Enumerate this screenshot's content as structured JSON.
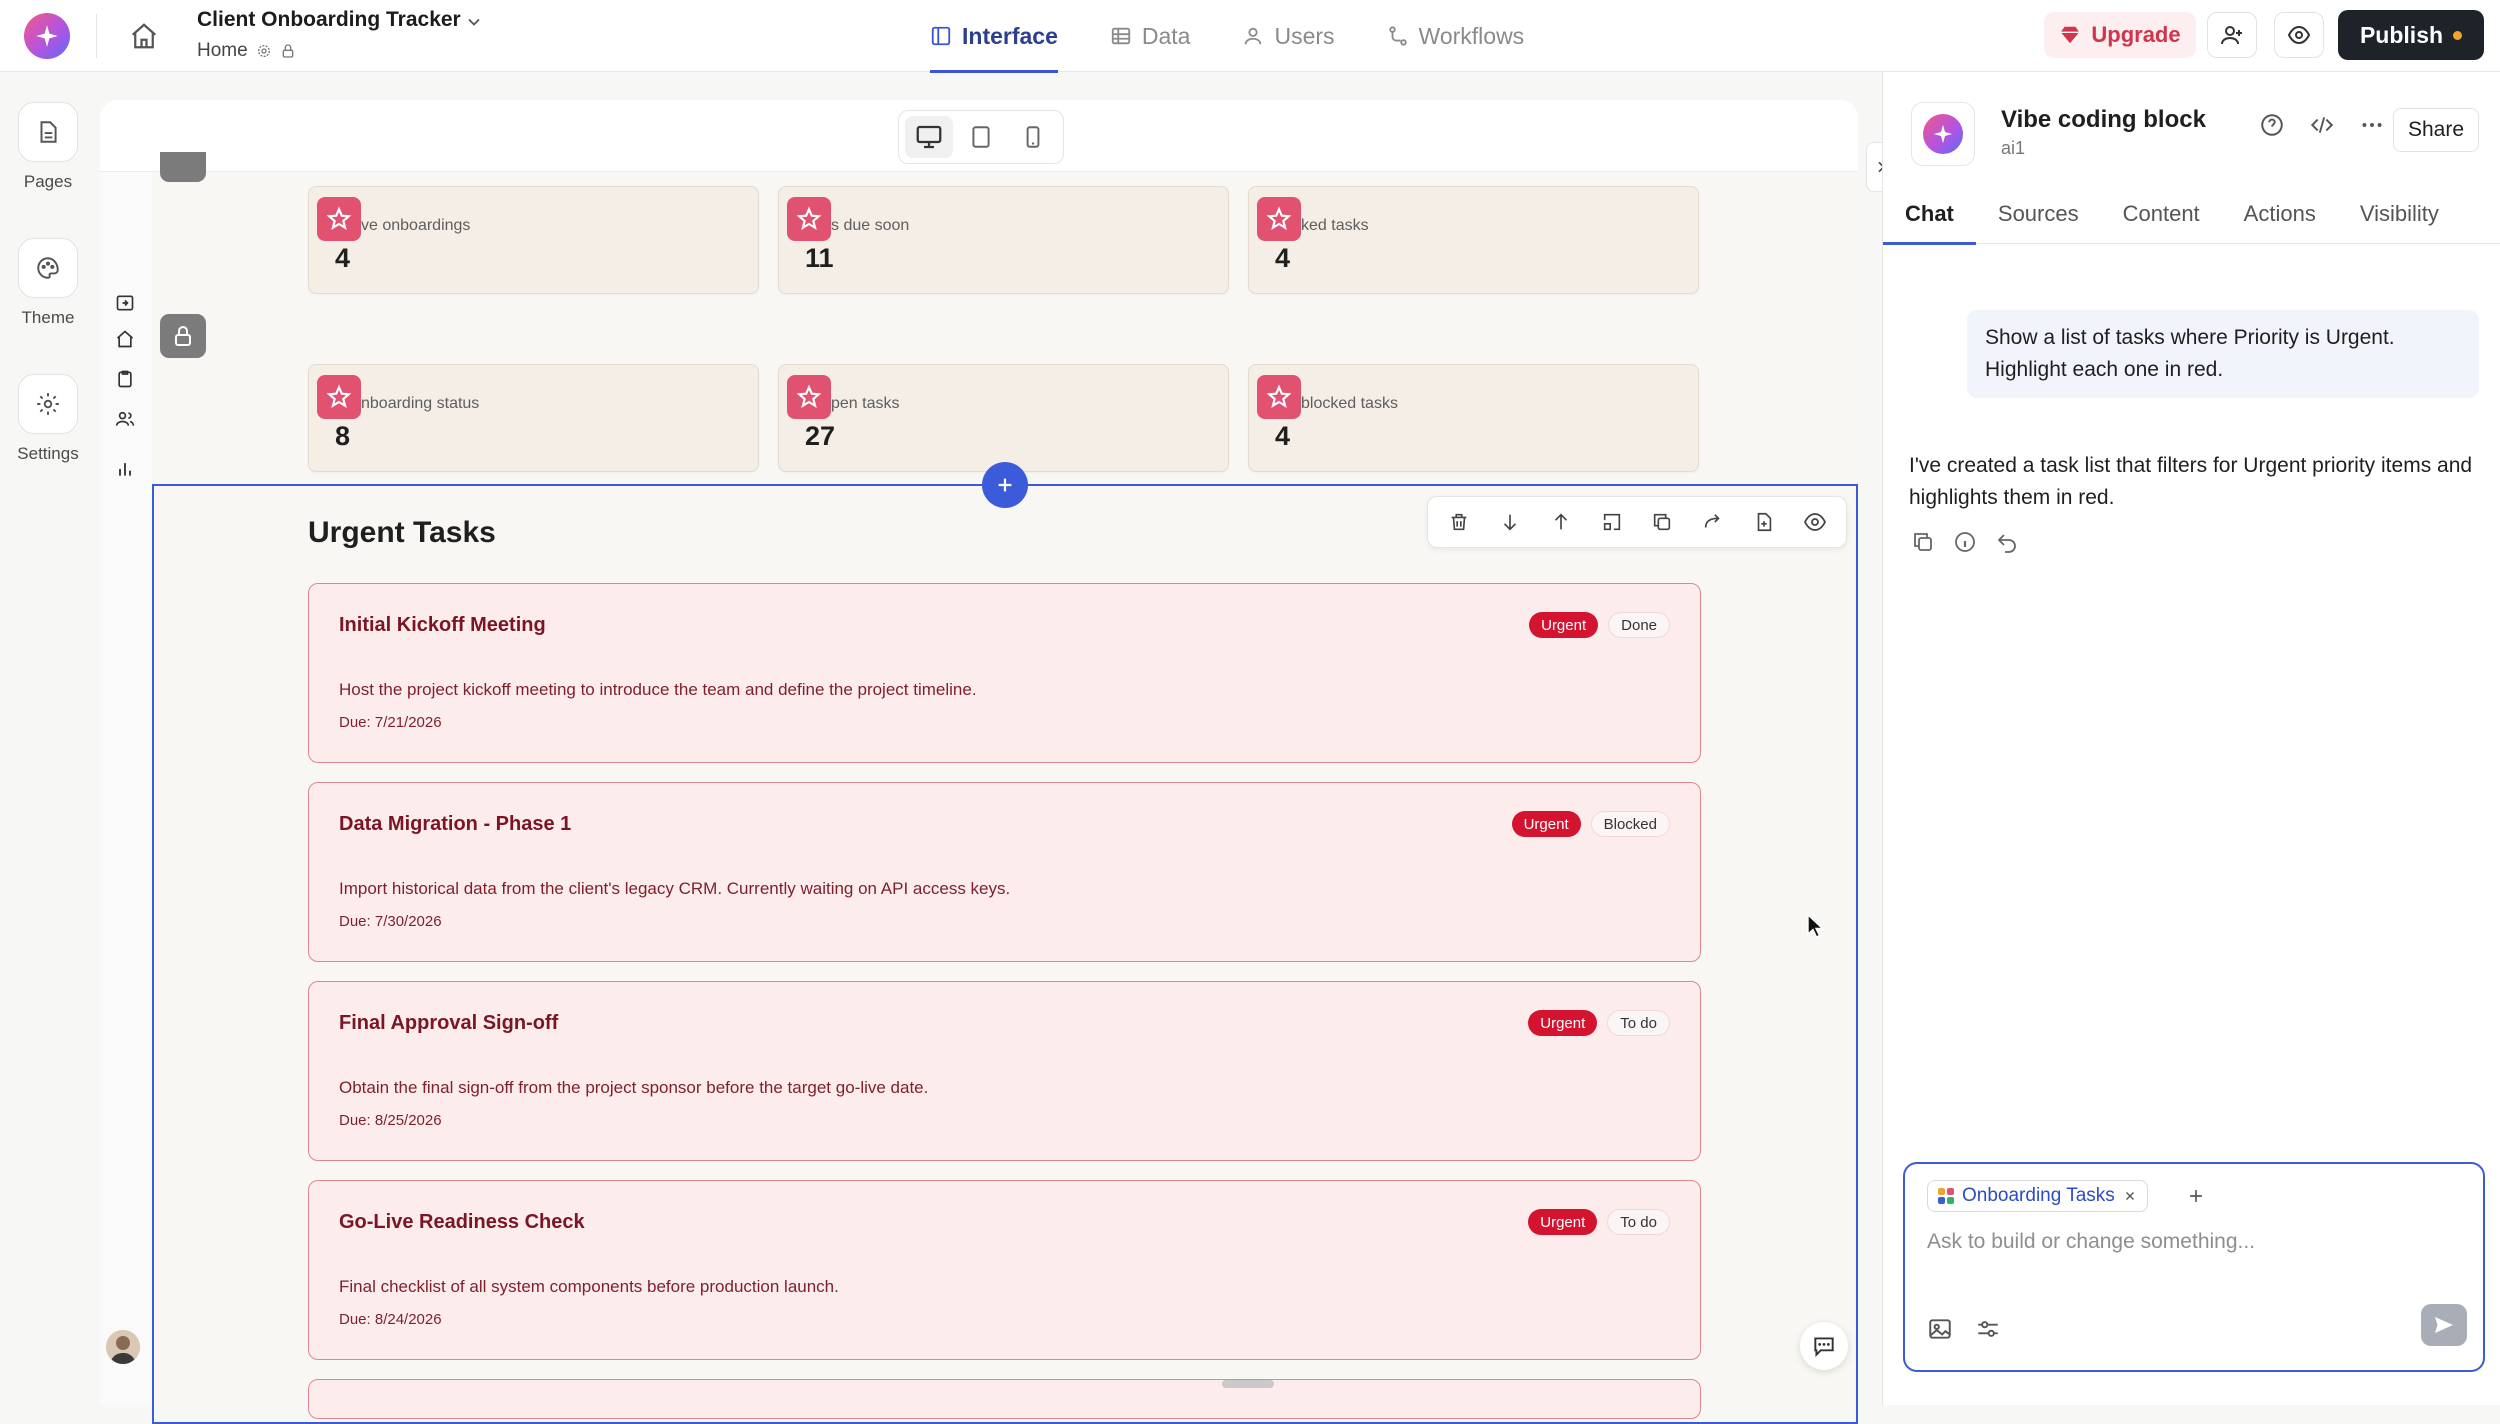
{
  "topbar": {
    "app_title": "Client Onboarding Tracker",
    "breadcrumb": "Home",
    "tabs": [
      {
        "label": "Interface",
        "icon": "layout-icon",
        "active": true
      },
      {
        "label": "Data",
        "icon": "table-icon",
        "active": false
      },
      {
        "label": "Users",
        "icon": "user-icon",
        "active": false
      },
      {
        "label": "Workflows",
        "icon": "workflow-icon",
        "active": false
      }
    ],
    "upgrade_label": "Upgrade",
    "publish_label": "Publish"
  },
  "leftrail": {
    "items": [
      {
        "label": "Pages",
        "icon": "document-icon"
      },
      {
        "label": "Theme",
        "icon": "palette-icon"
      },
      {
        "label": "Settings",
        "icon": "gear-icon"
      }
    ]
  },
  "stats": [
    {
      "label": "ve onboardings",
      "value": "4"
    },
    {
      "label": "s due soon",
      "value": "11"
    },
    {
      "label": "ked tasks",
      "value": "4"
    },
    {
      "label": "nboarding status",
      "value": "8"
    },
    {
      "label": "pen tasks",
      "value": "27"
    },
    {
      "label": "blocked tasks",
      "value": "4"
    }
  ],
  "section_title": "Urgent Tasks",
  "tasks": [
    {
      "title": "Initial Kickoff Meeting",
      "priority": "Urgent",
      "status": "Done",
      "description": "Host the project kickoff meeting to introduce the team and define the project timeline.",
      "due": "Due: 7/21/2026"
    },
    {
      "title": "Data Migration - Phase 1",
      "priority": "Urgent",
      "status": "Blocked",
      "description": "Import historical data from the client's legacy CRM. Currently waiting on API access keys.",
      "due": "Due: 7/30/2026"
    },
    {
      "title": "Final Approval Sign-off",
      "priority": "Urgent",
      "status": "To do",
      "description": "Obtain the final sign-off from the project sponsor before the target go-live date.",
      "due": "Due: 8/25/2026"
    },
    {
      "title": "Go-Live Readiness Check",
      "priority": "Urgent",
      "status": "To do",
      "description": "Final checklist of all system components before production launch.",
      "due": "Due: 8/24/2026"
    }
  ],
  "panel": {
    "title": "Vibe coding block",
    "subtitle": "ai1",
    "share_label": "Share",
    "tabs": [
      "Chat",
      "Sources",
      "Content",
      "Actions",
      "Visibility"
    ],
    "active_tab": "Chat",
    "user_message": "Show a list of tasks where Priority is Urgent. Highlight each one in red.",
    "ai_message": "I've created a task list that filters for Urgent priority items and highlights them in red.",
    "chip_label": "Onboarding Tasks",
    "composer_placeholder": "Ask to build or change something..."
  },
  "colors": {
    "accent": "#3b5bdb",
    "urgent": "#d3132f",
    "task_bg": "#fdecec",
    "task_border": "#e0878d",
    "publish_bg": "#1e2329",
    "upgrade_text": "#d1344d"
  }
}
